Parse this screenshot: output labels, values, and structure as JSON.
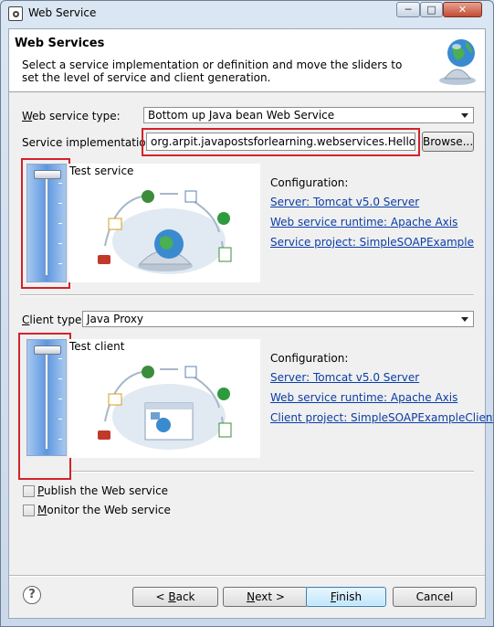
{
  "window": {
    "title": "Web Service",
    "minimize_glyph": "─",
    "maximize_glyph": "□",
    "close_glyph": "✕"
  },
  "header": {
    "title": "Web Services",
    "description": "Select a service implementation or definition and move the sliders to set the level of service and client generation."
  },
  "service": {
    "type_label_prefix": "W",
    "type_label_rest": "eb service type:",
    "type_value": "Bottom up Java bean Web Service",
    "impl_label": "Service implementation:",
    "impl_value": "org.arpit.javapostsforlearning.webservices.HelloWorld",
    "browse_label": "Browse...",
    "slider_caption": "Test service",
    "slider_level": 1,
    "config_heading": "Configuration:",
    "server_link": "Server: Tomcat v5.0 Server",
    "runtime_link": "Web service runtime: Apache Axis",
    "project_link": "Service project: SimpleSOAPExample"
  },
  "client": {
    "type_label_prefix": "C",
    "type_label_rest": "lient type:",
    "type_value": "Java Proxy",
    "slider_caption": "Test client",
    "slider_level": 1,
    "config_heading": "Configuration:",
    "server_link": "Server: Tomcat v5.0 Server",
    "runtime_link": "Web service runtime: Apache Axis",
    "project_link": "Client project: SimpleSOAPExampleClient"
  },
  "options": {
    "publish_prefix": "P",
    "publish_rest": "ublish the Web service",
    "publish_checked": false,
    "monitor_prefix": "M",
    "monitor_rest": "onitor the Web service",
    "monitor_checked": false
  },
  "buttons": {
    "help_glyph": "?",
    "back_prefix": "< ",
    "back_u": "B",
    "back_rest": "ack",
    "next_u": "N",
    "next_rest": "ext >",
    "finish_u": "F",
    "finish_rest": "inish",
    "cancel_label": "Cancel"
  },
  "colors": {
    "link": "#0b3da6",
    "highlight_box": "#d2232a"
  }
}
